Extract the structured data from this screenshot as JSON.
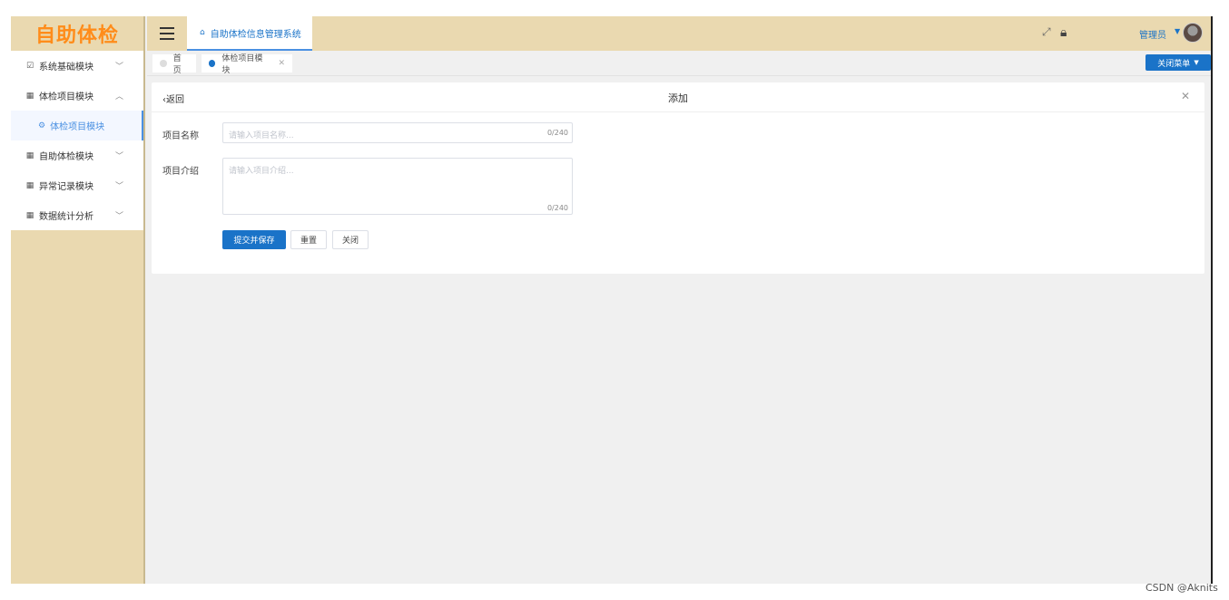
{
  "app": {
    "logo": "自助体检",
    "system_title": "自助体检信息管理系统"
  },
  "sidebar": {
    "items": [
      {
        "label": "系统基础模块",
        "icon": "check-square-icon",
        "expanded": false
      },
      {
        "label": "体检项目模块",
        "icon": "grid-icon",
        "expanded": true
      },
      {
        "label": "体检项目模块",
        "icon": "gear-icon",
        "sub": true,
        "active": true
      },
      {
        "label": "自助体检模块",
        "icon": "grid-icon",
        "expanded": false
      },
      {
        "label": "异常记录模块",
        "icon": "grid-icon",
        "expanded": false
      },
      {
        "label": "数据统计分析",
        "icon": "grid-icon",
        "expanded": false
      }
    ]
  },
  "header": {
    "admin": "管理员"
  },
  "tabs": [
    {
      "label": "首页",
      "active": false
    },
    {
      "label": "体检项目模块",
      "active": true
    }
  ],
  "close_menu": "关闭菜单",
  "card": {
    "back": "返回",
    "title": "添加",
    "fields": {
      "name": {
        "label": "项目名称",
        "placeholder": "请输入项目名称...",
        "counter": "0/240"
      },
      "intro": {
        "label": "项目介绍",
        "placeholder": "请输入项目介绍...",
        "counter": "0/240"
      }
    },
    "buttons": {
      "submit": "提交并保存",
      "reset": "重置",
      "close": "关闭"
    }
  },
  "watermark": "CSDN @Aknits",
  "colors": {
    "accent": "#1a73c8",
    "sidebar_bg": "#ead9b0",
    "logo": "#ff8c1a"
  }
}
